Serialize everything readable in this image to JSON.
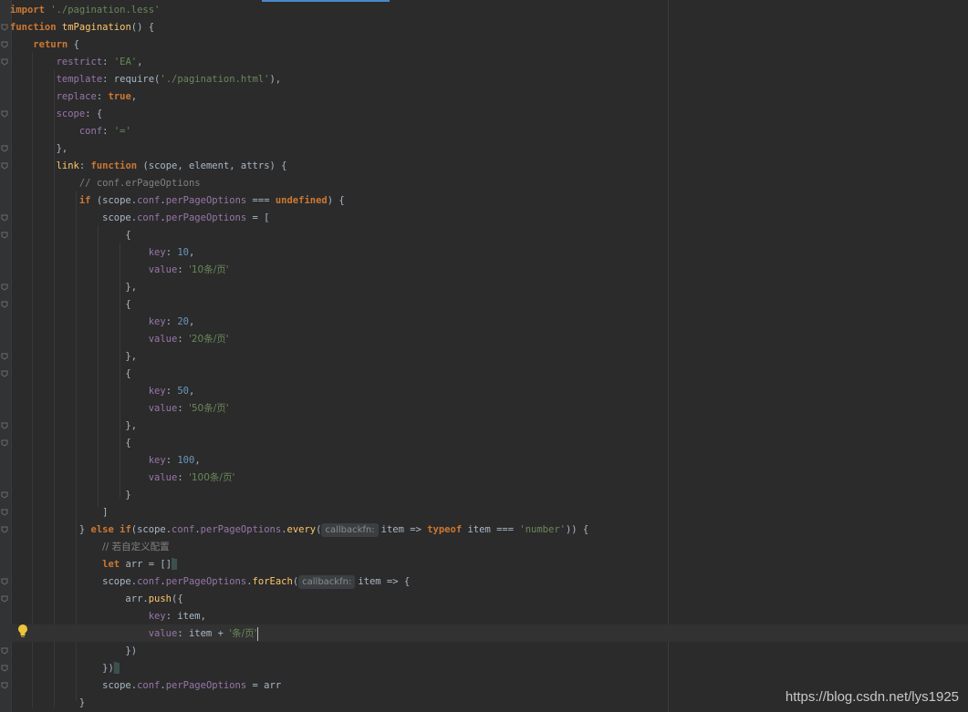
{
  "editor": {
    "lines": [
      [
        [
          "kw",
          "import "
        ],
        [
          "str",
          "'./pagination.less'"
        ]
      ],
      [
        [
          "kw",
          "function "
        ],
        [
          "fn",
          "tmPagination"
        ],
        [
          "plain",
          "() {"
        ]
      ],
      [
        [
          "plain",
          "    "
        ],
        [
          "kw",
          "return "
        ],
        [
          "plain",
          "{"
        ]
      ],
      [
        [
          "plain",
          "        "
        ],
        [
          "prop",
          "restrict"
        ],
        [
          "plain",
          ": "
        ],
        [
          "str",
          "'EA'"
        ],
        [
          "plain",
          ","
        ]
      ],
      [
        [
          "plain",
          "        "
        ],
        [
          "prop",
          "template"
        ],
        [
          "plain",
          ": require("
        ],
        [
          "str",
          "'./pagination.html'"
        ],
        [
          "plain",
          "),"
        ]
      ],
      [
        [
          "plain",
          "        "
        ],
        [
          "prop",
          "replace"
        ],
        [
          "plain",
          ": "
        ],
        [
          "kw",
          "true"
        ],
        [
          "plain",
          ","
        ]
      ],
      [
        [
          "plain",
          "        "
        ],
        [
          "prop",
          "scope"
        ],
        [
          "plain",
          ": {"
        ]
      ],
      [
        [
          "plain",
          "            "
        ],
        [
          "prop",
          "conf"
        ],
        [
          "plain",
          ": "
        ],
        [
          "str",
          "'='"
        ]
      ],
      [
        [
          "plain",
          "        },"
        ]
      ],
      [
        [
          "plain",
          "        "
        ],
        [
          "fn",
          "link"
        ],
        [
          "plain",
          ": "
        ],
        [
          "kw",
          "function "
        ],
        [
          "plain",
          "(scope, element, attrs) {"
        ]
      ],
      [
        [
          "plain",
          "            "
        ],
        [
          "cmt",
          "// conf.erPageOptions"
        ]
      ],
      [
        [
          "plain",
          "            "
        ],
        [
          "kw",
          "if "
        ],
        [
          "plain",
          "(scope."
        ],
        [
          "prop",
          "conf"
        ],
        [
          "plain",
          "."
        ],
        [
          "prop",
          "perPageOptions"
        ],
        [
          "plain",
          " === "
        ],
        [
          "kw",
          "undefined"
        ],
        [
          "plain",
          ") {"
        ]
      ],
      [
        [
          "plain",
          "                scope."
        ],
        [
          "prop",
          "conf"
        ],
        [
          "plain",
          "."
        ],
        [
          "prop",
          "perPageOptions"
        ],
        [
          "plain",
          " = ["
        ]
      ],
      [
        [
          "plain",
          "                    {"
        ]
      ],
      [
        [
          "plain",
          "                        "
        ],
        [
          "prop",
          "key"
        ],
        [
          "plain",
          ": "
        ],
        [
          "num",
          "10"
        ],
        [
          "plain",
          ","
        ]
      ],
      [
        [
          "plain",
          "                        "
        ],
        [
          "prop",
          "value"
        ],
        [
          "plain",
          ": "
        ],
        [
          "str",
          "'10条/页'"
        ]
      ],
      [
        [
          "plain",
          "                    },"
        ]
      ],
      [
        [
          "plain",
          "                    {"
        ]
      ],
      [
        [
          "plain",
          "                        "
        ],
        [
          "prop",
          "key"
        ],
        [
          "plain",
          ": "
        ],
        [
          "num",
          "20"
        ],
        [
          "plain",
          ","
        ]
      ],
      [
        [
          "plain",
          "                        "
        ],
        [
          "prop",
          "value"
        ],
        [
          "plain",
          ": "
        ],
        [
          "str",
          "'20条/页'"
        ]
      ],
      [
        [
          "plain",
          "                    },"
        ]
      ],
      [
        [
          "plain",
          "                    {"
        ]
      ],
      [
        [
          "plain",
          "                        "
        ],
        [
          "prop",
          "key"
        ],
        [
          "plain",
          ": "
        ],
        [
          "num",
          "50"
        ],
        [
          "plain",
          ","
        ]
      ],
      [
        [
          "plain",
          "                        "
        ],
        [
          "prop",
          "value"
        ],
        [
          "plain",
          ": "
        ],
        [
          "str",
          "'50条/页'"
        ]
      ],
      [
        [
          "plain",
          "                    },"
        ]
      ],
      [
        [
          "plain",
          "                    {"
        ]
      ],
      [
        [
          "plain",
          "                        "
        ],
        [
          "prop",
          "key"
        ],
        [
          "plain",
          ": "
        ],
        [
          "num",
          "100"
        ],
        [
          "plain",
          ","
        ]
      ],
      [
        [
          "plain",
          "                        "
        ],
        [
          "prop",
          "value"
        ],
        [
          "plain",
          ": "
        ],
        [
          "str",
          "'100条/页'"
        ]
      ],
      [
        [
          "plain",
          "                    }"
        ]
      ],
      [
        [
          "plain",
          "                ]"
        ]
      ],
      [
        [
          "plain",
          "            } "
        ],
        [
          "kw",
          "else if"
        ],
        [
          "plain",
          "(scope."
        ],
        [
          "prop",
          "conf"
        ],
        [
          "plain",
          "."
        ],
        [
          "prop",
          "perPageOptions"
        ],
        [
          "plain",
          "."
        ],
        [
          "meth",
          "every"
        ],
        [
          "plain",
          "("
        ],
        [
          "hint",
          "callbackfn:"
        ],
        [
          "plain",
          "item => "
        ],
        [
          "kw",
          "typeof "
        ],
        [
          "plain",
          "item === "
        ],
        [
          "str",
          "'number'"
        ],
        [
          "plain",
          ")) {"
        ]
      ],
      [
        [
          "plain",
          "                "
        ],
        [
          "cmt",
          "// 若自定义配置"
        ]
      ],
      [
        [
          "plain",
          "                "
        ],
        [
          "kw",
          "let "
        ],
        [
          "plain",
          "arr = []"
        ],
        [
          "bracket",
          "▌"
        ]
      ],
      [
        [
          "plain",
          "                scope."
        ],
        [
          "prop",
          "conf"
        ],
        [
          "plain",
          "."
        ],
        [
          "prop",
          "perPageOptions"
        ],
        [
          "plain",
          "."
        ],
        [
          "meth",
          "forEach"
        ],
        [
          "plain",
          "("
        ],
        [
          "hint",
          "callbackfn:"
        ],
        [
          "plain",
          "item => {"
        ]
      ],
      [
        [
          "plain",
          "                    arr."
        ],
        [
          "meth",
          "push"
        ],
        [
          "plain",
          "({"
        ]
      ],
      [
        [
          "plain",
          "                        "
        ],
        [
          "prop",
          "key"
        ],
        [
          "plain",
          ": item,"
        ]
      ],
      [
        [
          "plain",
          "                        "
        ],
        [
          "prop",
          "value"
        ],
        [
          "plain",
          ": item + "
        ],
        [
          "str",
          "'条/页'"
        ],
        [
          "caret",
          ""
        ]
      ],
      [
        [
          "plain",
          "                    })"
        ]
      ],
      [
        [
          "plain",
          "                })"
        ],
        [
          "bracket",
          "▌"
        ]
      ],
      [
        [
          "plain",
          "                scope."
        ],
        [
          "prop",
          "conf"
        ],
        [
          "plain",
          "."
        ],
        [
          "prop",
          "perPageOptions"
        ],
        [
          "plain",
          " = arr"
        ]
      ],
      [
        [
          "plain",
          "            }"
        ]
      ]
    ],
    "watermark": "https://blog.csdn.net/lys1925"
  },
  "colors": {
    "background": "#2b2b2b",
    "keyword": "#cc7832",
    "string": "#6a8759",
    "property": "#9876aa",
    "number": "#6897bb",
    "comment": "#808080",
    "function": "#ffc66d",
    "text": "#a9b7c6"
  },
  "icons": {
    "gutter": "fold-marker-icon",
    "intention": "lightbulb-icon"
  }
}
